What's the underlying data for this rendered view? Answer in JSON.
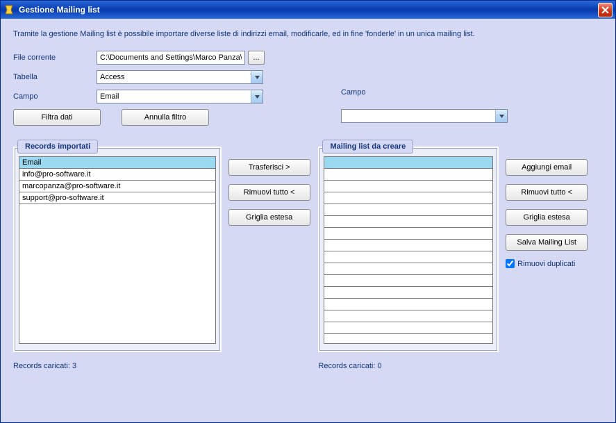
{
  "window": {
    "title": "Gestione Mailing list"
  },
  "description": "Tramite la gestione Mailing list è possibile importare diverse liste di indirizzi email, modificarle, ed in fine 'fonderle' in un unica mailing list.",
  "form": {
    "file_label": "File corrente",
    "file_value": "C:\\Documents and Settings\\Marco Panza\\",
    "browse_label": "...",
    "table_label": "Tabella",
    "table_value": "Access",
    "field_label": "Campo",
    "field_value": "Email",
    "filter_btn": "Filtra dati",
    "clear_filter_btn": "Annulla filtro"
  },
  "right_field": {
    "label": "Campo",
    "value": ""
  },
  "left_panel": {
    "header": "Records importati",
    "grid_header": "Email",
    "rows": [
      "info@pro-software.it",
      "marcopanza@pro-software.it",
      "support@pro-software.it"
    ],
    "footer": "Records caricati: 3"
  },
  "mid_buttons": {
    "transfer": "Trasferisci >",
    "remove_all": "Rimuovi tutto <",
    "extended_grid": "Griglia estesa"
  },
  "right_panel": {
    "header": "Mailing list da creare",
    "grid_header": "",
    "footer": "Records caricati: 0"
  },
  "right_buttons": {
    "add_email": "Aggiungi email",
    "remove_all": "Rimuovi tutto <",
    "extended_grid": "Griglia estesa",
    "save_list": "Salva Mailing List",
    "remove_duplicates_label": "Rimuovi duplicati",
    "remove_duplicates_checked": true
  }
}
